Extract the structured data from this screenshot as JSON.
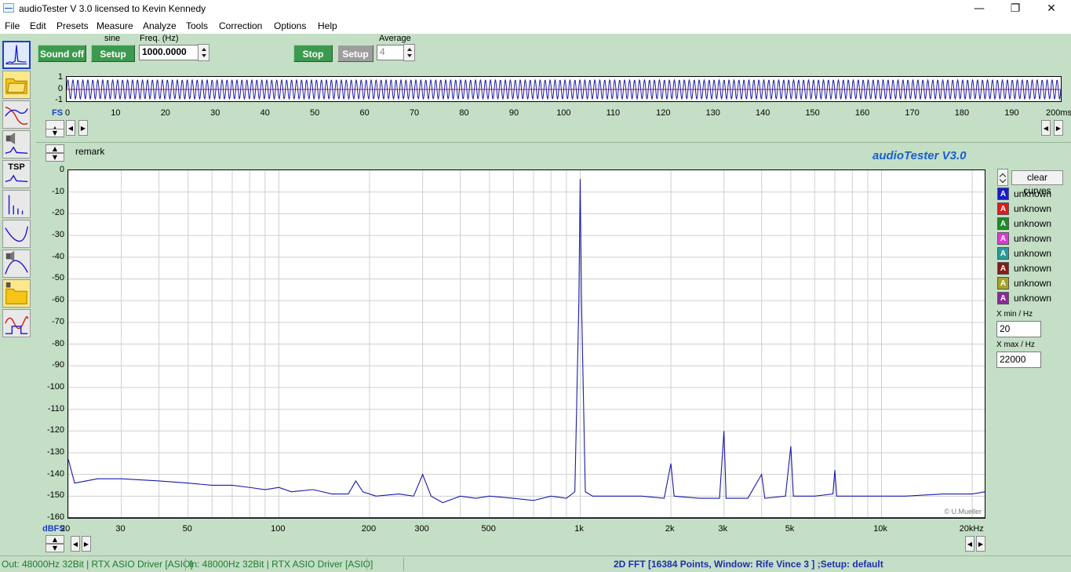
{
  "window": {
    "title": "audioTester  V 3.0   licensed to Kevin Kennedy",
    "minimize": "—",
    "restore": "❐",
    "close": "✕"
  },
  "menu": [
    "File",
    "Edit",
    "Presets",
    "Measure",
    "Analyze",
    "Tools",
    "Correction",
    "Options",
    "Help"
  ],
  "toolbar": {
    "sound_off": "Sound off",
    "sine_label": "sine",
    "setup": "Setup",
    "freq_label": "Freq. (Hz)",
    "freq_value": "1000.0000",
    "stop": "Stop",
    "setup2": "Setup",
    "average_label": "Average",
    "average_value": "4"
  },
  "sidebar": {
    "tools": [
      "fft-spectrum",
      "presets-folder",
      "frequency-response",
      "impedance",
      "tsp",
      "distortion",
      "filter-curve",
      "speaker-response",
      "presets-folder-2",
      "waveform"
    ],
    "tsp_label": "TSP"
  },
  "oscilloscope": {
    "y_ticks": [
      "1",
      "0",
      "-1"
    ],
    "x_ticks": [
      "0",
      "10",
      "20",
      "30",
      "40",
      "50",
      "60",
      "70",
      "80",
      "90",
      "100",
      "110",
      "120",
      "130",
      "140",
      "150",
      "160",
      "170",
      "180",
      "190",
      "200ms"
    ],
    "fs_label": "FS",
    "signal": "sine 1000 Hz",
    "colors": {
      "left": "#1a1aa8",
      "right": "#d01c1c"
    }
  },
  "panel": {
    "remark": "remark",
    "brand": "audioTester  V3.0",
    "footnote": "© U.Mueller",
    "y_unit": "dBFS"
  },
  "chart_data": {
    "type": "line",
    "xscale": "log",
    "xlim": [
      20,
      22000
    ],
    "ylim": [
      -160,
      0
    ],
    "y_ticks": [
      "0",
      "-10",
      "-20",
      "-30",
      "-40",
      "-50",
      "-60",
      "-70",
      "-80",
      "-90",
      "-100",
      "-110",
      "-120",
      "-130",
      "-140",
      "-150",
      "-160"
    ],
    "x_tick_labels": [
      "20",
      "30",
      "50",
      "100",
      "200",
      "300",
      "500",
      "1k",
      "2k",
      "3k",
      "5k",
      "10k",
      "20kHz"
    ],
    "grid": true,
    "series": [
      {
        "color": "#1a1aa8",
        "points": [
          [
            20,
            -133
          ],
          [
            21,
            -144
          ],
          [
            25,
            -142
          ],
          [
            30,
            -142
          ],
          [
            40,
            -143
          ],
          [
            50,
            -144
          ],
          [
            60,
            -145
          ],
          [
            70,
            -145
          ],
          [
            80,
            -146
          ],
          [
            90,
            -147
          ],
          [
            100,
            -146
          ],
          [
            110,
            -148
          ],
          [
            130,
            -147
          ],
          [
            150,
            -149
          ],
          [
            170,
            -149
          ],
          [
            180,
            -143
          ],
          [
            190,
            -148
          ],
          [
            210,
            -150
          ],
          [
            250,
            -149
          ],
          [
            280,
            -150
          ],
          [
            300,
            -140
          ],
          [
            320,
            -150
          ],
          [
            350,
            -153
          ],
          [
            400,
            -150
          ],
          [
            450,
            -151
          ],
          [
            500,
            -150
          ],
          [
            600,
            -151
          ],
          [
            700,
            -152
          ],
          [
            800,
            -150
          ],
          [
            900,
            -151
          ],
          [
            960,
            -148
          ],
          [
            990,
            -60
          ],
          [
            1000,
            -4
          ],
          [
            1010,
            -60
          ],
          [
            1040,
            -148
          ],
          [
            1100,
            -150
          ],
          [
            1300,
            -150
          ],
          [
            1600,
            -150
          ],
          [
            1900,
            -151
          ],
          [
            2000,
            -135
          ],
          [
            2050,
            -150
          ],
          [
            2500,
            -151
          ],
          [
            2900,
            -151
          ],
          [
            3000,
            -120
          ],
          [
            3050,
            -151
          ],
          [
            3600,
            -151
          ],
          [
            4000,
            -140
          ],
          [
            4100,
            -151
          ],
          [
            4800,
            -150
          ],
          [
            5000,
            -127
          ],
          [
            5100,
            -150
          ],
          [
            6000,
            -150
          ],
          [
            6900,
            -149
          ],
          [
            7000,
            -138
          ],
          [
            7100,
            -150
          ],
          [
            9000,
            -150
          ],
          [
            12000,
            -150
          ],
          [
            16000,
            -149
          ],
          [
            20000,
            -149
          ],
          [
            22000,
            -148
          ]
        ]
      },
      {
        "color": "#e01a1a",
        "points": [
          [
            20,
            -160
          ],
          [
            22000,
            -160
          ]
        ]
      }
    ]
  },
  "legend": {
    "clear_curves": "clear curves",
    "items": [
      {
        "name": "unknown",
        "color": "#1a1ad0"
      },
      {
        "name": "unknown",
        "color": "#e01a1a"
      },
      {
        "name": "unknown",
        "color": "#1e8a2a"
      },
      {
        "name": "unknown",
        "color": "#e038d8"
      },
      {
        "name": "unknown",
        "color": "#2a9a9a"
      },
      {
        "name": "unknown",
        "color": "#8a1a1a"
      },
      {
        "name": "unknown",
        "color": "#a3a32a"
      },
      {
        "name": "unknown",
        "color": "#8a2a9a"
      }
    ],
    "glyph": "A",
    "xmin_label": "X min / Hz",
    "xmin_value": "20",
    "xmax_label": "X max / Hz",
    "xmax_value": "22000"
  },
  "status": {
    "out": "Out: 48000Hz 32Bit  | RTX ASIO Driver [ASIO]",
    "in": "In: 48000Hz 32Bit  | RTX ASIO Driver [ASIO]",
    "fft": "2D FFT [16384 Points, Window: Rife Vince 3 ]  ;Setup:  default"
  }
}
